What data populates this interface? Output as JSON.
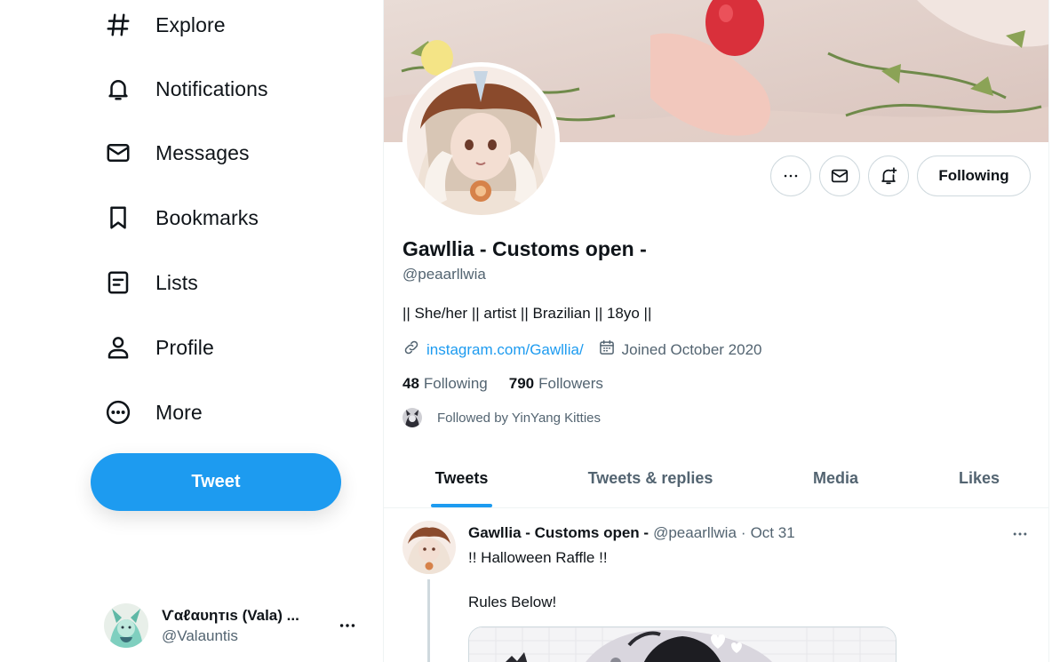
{
  "sidebar": {
    "items": [
      {
        "label": "Explore",
        "icon": "hashtag-icon"
      },
      {
        "label": "Notifications",
        "icon": "bell-icon"
      },
      {
        "label": "Messages",
        "icon": "envelope-icon"
      },
      {
        "label": "Bookmarks",
        "icon": "bookmark-icon"
      },
      {
        "label": "Lists",
        "icon": "list-icon"
      },
      {
        "label": "Profile",
        "icon": "person-icon"
      },
      {
        "label": "More",
        "icon": "more-circle-icon"
      }
    ],
    "tweet_button": "Tweet",
    "account": {
      "name": "Ѵαℓαυηтιѕ (Vala) ...",
      "handle": "@Valauntis"
    }
  },
  "profile": {
    "name": "Gawllia - Customs open -",
    "handle": "@peaarllwia",
    "bio": "|| She/her || artist || Brazilian || 18yo ||",
    "link": "instagram.com/Gawllia/",
    "joined": "Joined October 2020",
    "following_count": "48",
    "following_label": "Following",
    "followers_count": "790",
    "followers_label": "Followers",
    "followed_by": "Followed by YinYang Kitties",
    "following_button": "Following"
  },
  "tabs": [
    {
      "label": "Tweets",
      "active": true
    },
    {
      "label": "Tweets & replies",
      "active": false
    },
    {
      "label": "Media",
      "active": false
    },
    {
      "label": "Likes",
      "active": false
    }
  ],
  "tweet": {
    "name": "Gawllia - Customs open -",
    "handle": "@peaarllwia",
    "separator": "·",
    "date": "Oct 31",
    "line1": "!! Halloween Raffle !!",
    "line2": "Rules Below!"
  },
  "colors": {
    "accent": "#1d9bf0",
    "text": "#0f1419",
    "secondary": "#536471",
    "border": "#cfd9de"
  }
}
